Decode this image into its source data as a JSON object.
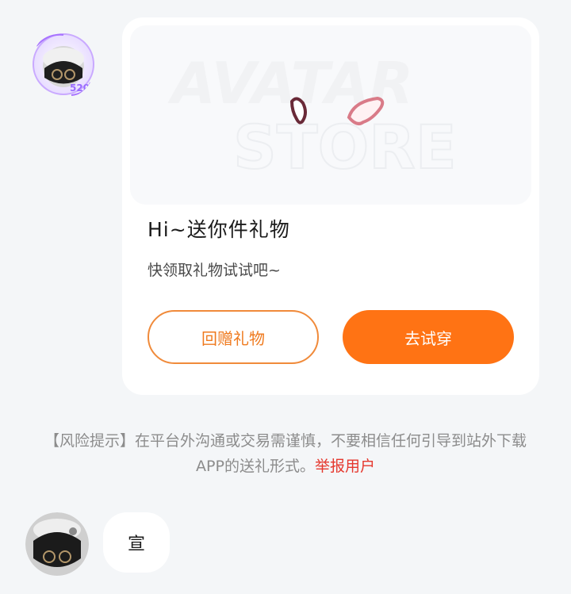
{
  "chat": {
    "gift_card": {
      "banner_text_line1": "AVATAR",
      "banner_text_line2": "STORE",
      "title": "Hi~送你件礼物",
      "subtitle": "快领取礼物试试吧~",
      "return_gift_label": "回赠礼物",
      "try_on_label": "去试穿",
      "colors": {
        "accent": "#ff7314",
        "accent_outline": "#f08a3a"
      }
    },
    "risk_notice": {
      "text": "【风险提示】在平台外沟通或交易需谨慎，不要相信任何引导到站外下载APP的送礼形式。",
      "report_link": "举报用户",
      "link_color": "#e5382e"
    },
    "message": {
      "text": "宣"
    },
    "avatar_badge": "520"
  }
}
